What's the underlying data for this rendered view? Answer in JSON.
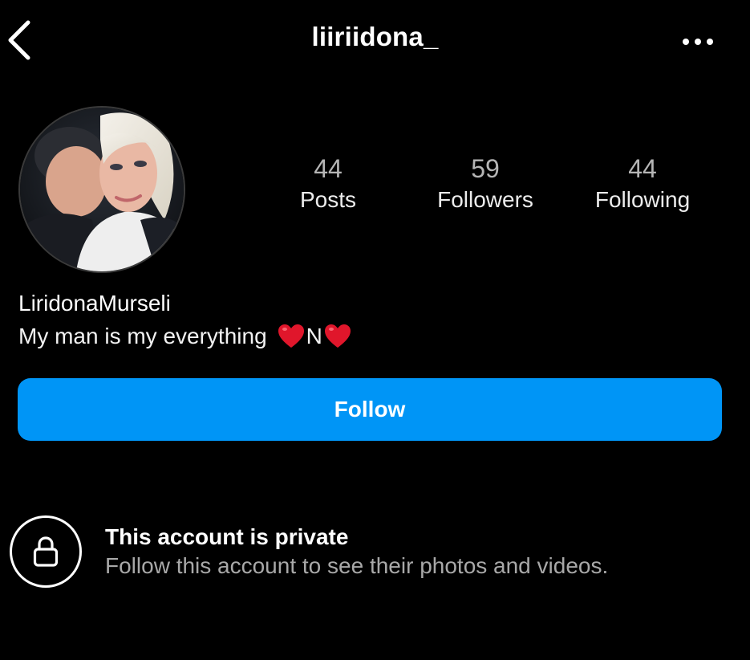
{
  "header": {
    "back_icon": "chevron-left-icon",
    "username": "liiriidona_",
    "more_icon": "more-horizontal-icon"
  },
  "profile": {
    "avatar_icon": "profile-photo",
    "stats": {
      "posts": {
        "value": "44",
        "label": "Posts"
      },
      "followers": {
        "value": "59",
        "label": "Followers"
      },
      "following": {
        "value": "44",
        "label": "Following"
      }
    },
    "display_name": "LiridonaMurseli",
    "bio": {
      "text": "My man is my everything",
      "emoji_1": "❤️",
      "letter": "N",
      "emoji_2": "❤️"
    }
  },
  "follow_button": {
    "label": "Follow",
    "color": "#0095f6"
  },
  "private_notice": {
    "icon": "lock-icon",
    "title": "This account is private",
    "subtitle": "Follow this account to see their photos and videos."
  },
  "colors": {
    "background": "#000000",
    "text_primary": "#ffffff",
    "text_secondary": "#a8a8a8",
    "heart": "#e0162b"
  }
}
